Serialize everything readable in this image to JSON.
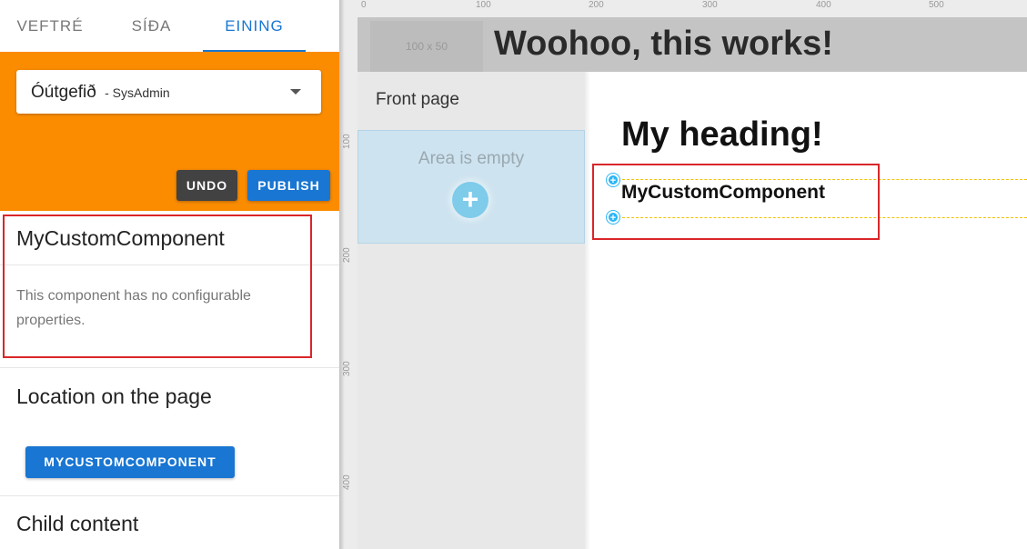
{
  "tabs": [
    "VEFTRÉ",
    "SÍÐA",
    "EINING"
  ],
  "select": {
    "value": "Óútgefið",
    "sub": "- SysAdmin"
  },
  "buttons": {
    "undo": "UNDO",
    "publish": "PUBLISH",
    "location": "MYCUSTOMCOMPONENT"
  },
  "component_card": {
    "title": "MyCustomComponent",
    "description": "This component has no configurable properties."
  },
  "location": {
    "title": "Location on the page"
  },
  "child_content": {
    "title": "Child content"
  },
  "rulers": {
    "top": [
      "0",
      "100",
      "200",
      "300",
      "400",
      "500"
    ],
    "left": [
      "100",
      "200",
      "300",
      "400"
    ]
  },
  "canvas": {
    "placeholder": "100 x 50",
    "banner": "Woohoo, this works!",
    "front_page": "Front page",
    "empty_area": "Area is empty",
    "add_icon": "+",
    "heading": "My heading!",
    "component": "MyCustomComponent"
  },
  "colors": {
    "accent": "#1976d2",
    "orange": "#fb8c00",
    "highlight": "#d9262a"
  }
}
